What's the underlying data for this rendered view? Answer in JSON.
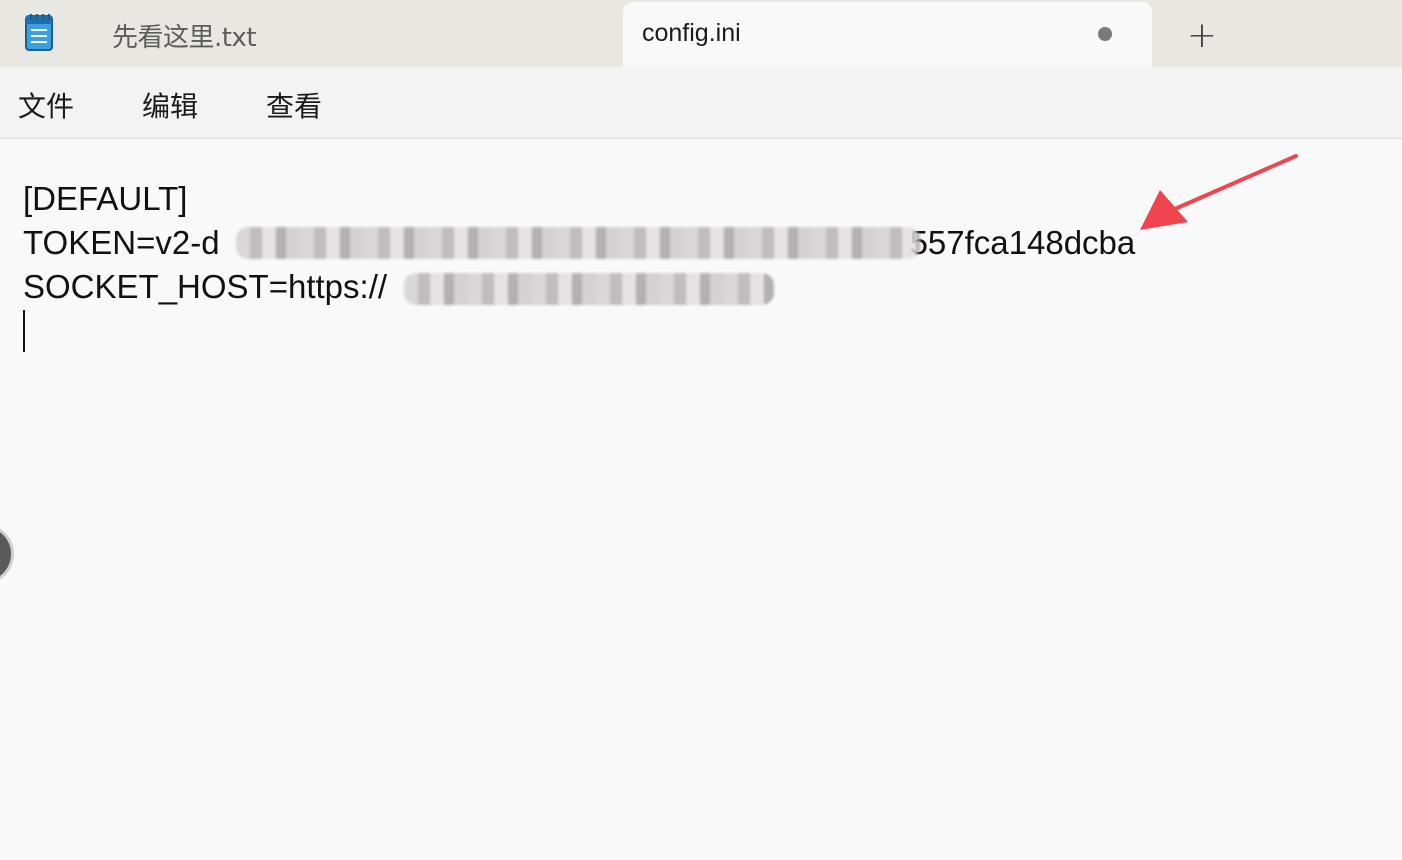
{
  "tabs": [
    {
      "label": "先看这里.txt",
      "active": false
    },
    {
      "label": "config.ini",
      "active": true,
      "unsaved": true
    }
  ],
  "new_tab_glyph": "+",
  "menu": {
    "file": "文件",
    "edit": "编辑",
    "view": "查看"
  },
  "editor": {
    "lines": [
      {
        "text": "[DEFAULT]"
      },
      {
        "prefix": "TOKEN=v2-d",
        "redacted": true,
        "suffix": "557fca148dcba"
      },
      {
        "prefix": "SOCKET_HOST=https://",
        "redacted": true,
        "suffix": ""
      },
      {
        "text": ""
      }
    ]
  },
  "colors": {
    "tabbar_bg": "#e9e7e2",
    "editor_bg": "#f9f9f9",
    "annotation_arrow": "#f0444f"
  },
  "icons": {
    "app": "notepad-icon",
    "unsaved": "unsaved-dot-icon",
    "new_tab": "plus-icon",
    "annotation": "red-arrow-icon"
  }
}
